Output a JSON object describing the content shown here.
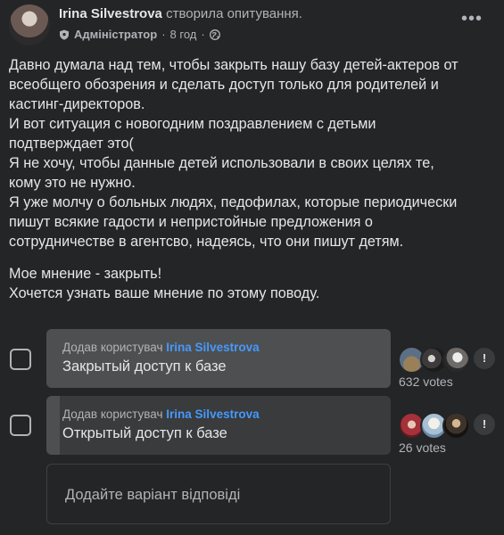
{
  "post": {
    "author": "Irina Silvestrova",
    "action": "створила опитування.",
    "role": "Адміністратор",
    "time": "8 год",
    "role_icon": "shield-icon",
    "audience_icon": "globe-icon",
    "more_icon": "more-icon",
    "paragraphs": [
      "Давно думала над тем, чтобы закрыть нашу базу детей-актеров от\nвсеобщего обозрения и сделать доступ только для родителей и\nкастинг-директоров.\nИ вот ситуация с новогодним поздравлением с детьми\nподтверждает это(\nЯ не хочу, чтобы данные детей использовали в своих целях те,\nкому это не нужно.\nЯ уже молчу о больных людях, педофилах, которые периодически\nпишут всякие гадости и непристойные предложения о\nсотрудничестве в агентсво, надеясь, что они пишут детям.",
      "Мое мнение - закрыть!\nХочется узнать ваше мнение по этому поводу."
    ]
  },
  "poll": {
    "options": [
      {
        "added_prefix": "Додав користувач",
        "added_by": "Irina Silvestrova",
        "label": "Закрытый доступ к базе",
        "votes": "632 votes",
        "share": 1.0,
        "report_icon": "report-icon"
      },
      {
        "added_prefix": "Додав користувач",
        "added_by": "Irina Silvestrova",
        "label": "Открытый доступ к базе",
        "votes": "26 votes",
        "share": 0.04,
        "report_icon": "report-icon"
      }
    ],
    "add_placeholder": "Додайте варіант відповіді"
  },
  "colors": {
    "background": "#242526",
    "option_bg": "#3a3b3c",
    "option_fill": "#4e4f50",
    "link": "#4599ff"
  }
}
